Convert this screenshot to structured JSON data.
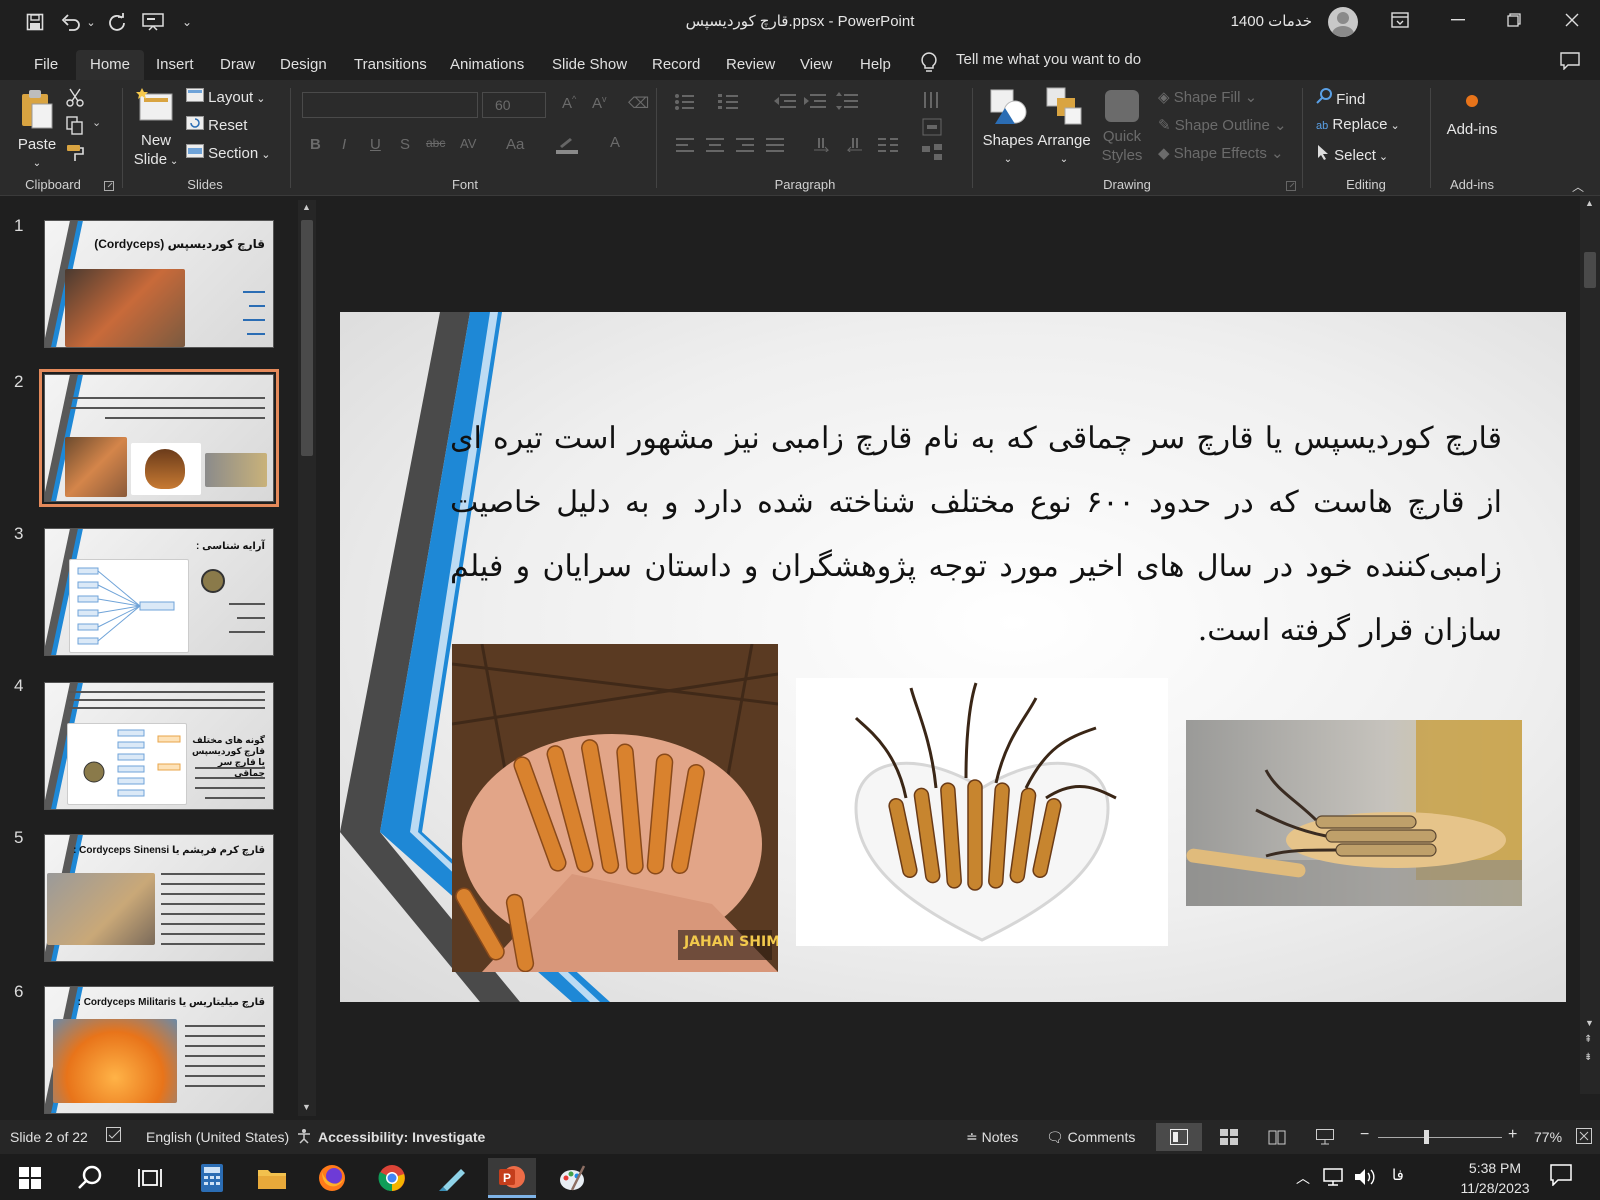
{
  "window": {
    "title": "قارچ کوردیسپس.ppsx  -  PowerPoint",
    "user_name": "خدمات 1400"
  },
  "menu_tabs": [
    "File",
    "Home",
    "Insert",
    "Draw",
    "Design",
    "Transitions",
    "Animations",
    "Slide Show",
    "Record",
    "Review",
    "View",
    "Help"
  ],
  "tell_me": "Tell me what you want to do",
  "ribbon": {
    "clipboard": {
      "label": "Clipboard",
      "paste": "Paste"
    },
    "slides": {
      "label": "Slides",
      "new_slide_1": "New",
      "new_slide_2": "Slide",
      "layout": "Layout",
      "reset": "Reset",
      "section": "Section"
    },
    "font": {
      "label": "Font",
      "size": "60"
    },
    "paragraph": {
      "label": "Paragraph"
    },
    "drawing": {
      "label": "Drawing",
      "shapes": "Shapes",
      "arrange": "Arrange",
      "quick_styles_1": "Quick",
      "quick_styles_2": "Styles",
      "shape_fill": "Shape Fill",
      "shape_outline": "Shape Outline",
      "shape_effects": "Shape Effects"
    },
    "editing": {
      "label": "Editing",
      "find": "Find",
      "replace": "Replace",
      "select": "Select"
    },
    "addins": {
      "label": "Add-ins",
      "button": "Add-ins"
    }
  },
  "thumbnails": [
    {
      "num": "1",
      "title": "قارچ کوردیسپس (Cordyceps)"
    },
    {
      "num": "2",
      "title": ""
    },
    {
      "num": "3",
      "title": "آرایه شناسی :"
    },
    {
      "num": "4",
      "title": "گونه های مختلف قارچ کوردیسپس یا قارچ سر چماقی"
    },
    {
      "num": "5",
      "title": "قارچ کرم فرپشم یا Cordyceps Sinensi :"
    },
    {
      "num": "6",
      "title": "قارچ میلیتاریس یا Cordyceps Militaris :"
    }
  ],
  "slide": {
    "body": "قارچ کوردیسپس یا قارچ سر چماقی که به نام قارچ زامبی نیز مشهور است تیره ای از قارچ هاست که در حدود ۶۰۰ نوع مختلف شناخته شده دارد و به دلیل خاصیت زامبی‌کننده خود در سال های اخیر مورد توجه پژوهشگران و داستان سرایان و فیلم سازان قرار گرفته است.",
    "watermark": "JAHAN SHIMI.COM"
  },
  "status": {
    "slide_info": "Slide 2 of 22",
    "language": "English (United States)",
    "accessibility": "Accessibility: Investigate",
    "notes": "Notes",
    "comments": "Comments",
    "zoom": "77%"
  },
  "taskbar": {
    "time": "5:38 PM",
    "date": "11/28/2023",
    "lang": "فا"
  },
  "colors": {
    "accent_blue": "#1e88d6",
    "selected_thumb": "#e58a5b",
    "ribbon_bg": "#2b2b2b"
  }
}
